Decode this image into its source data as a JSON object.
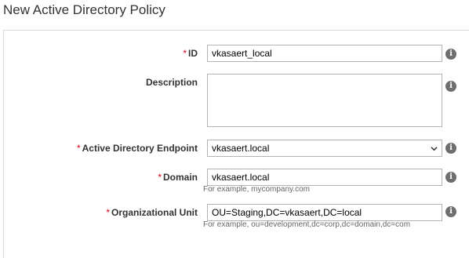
{
  "page_title": "New Active Directory Policy",
  "required_marker": "*",
  "info_glyph": "i",
  "fields": {
    "id": {
      "label": "ID",
      "value": "vkasaert_local",
      "required": true
    },
    "description": {
      "label": "Description",
      "value": "",
      "required": false
    },
    "endpoint": {
      "label": "Active Directory Endpoint",
      "value": "vkasaert.local",
      "required": true
    },
    "domain": {
      "label": "Domain",
      "value": "vkasaert.local",
      "required": true,
      "hint": "For example, mycompany.com"
    },
    "ou": {
      "label": "Organizational Unit",
      "value": "OU=Staging,DC=vkasaert,DC=local",
      "required": true,
      "hint": "For example, ou=development,dc=corp,dc=domain,dc=com"
    }
  },
  "colors": {
    "required": "#d9001b",
    "info_icon": "#6e6e6e",
    "border": "#b3b3b3"
  },
  "icons": [
    "info-icon",
    "chevron-down-icon"
  ]
}
